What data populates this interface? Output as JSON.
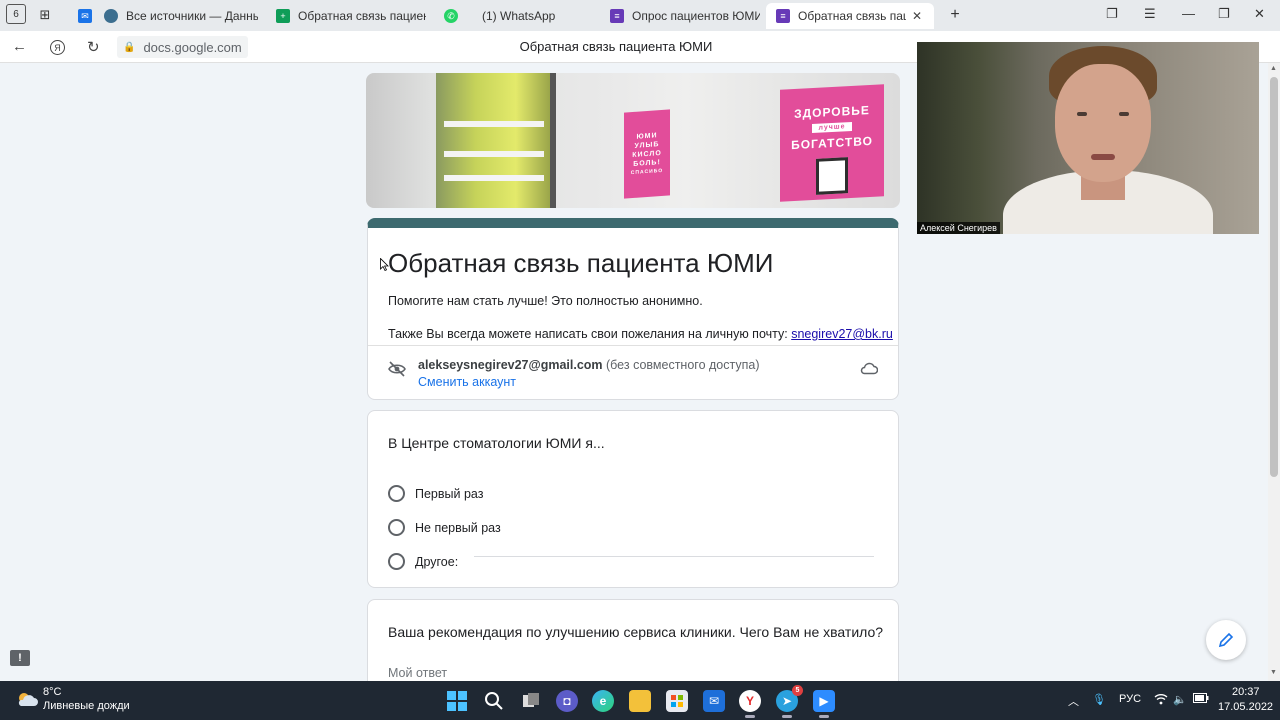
{
  "tabs": [
    {
      "label": "Все источники — Данные",
      "favicon_color": "#3c6e8f"
    },
    {
      "label": "Обратная связь пациента",
      "favicon_color": "#0f9d58"
    },
    {
      "label": "(1) WhatsApp",
      "favicon_color": "#25d366"
    },
    {
      "label": "Опрос пациентов ЮМИ",
      "favicon_color": "#673ab7"
    },
    {
      "label": "Обратная связь пациента",
      "favicon_color": "#673ab7",
      "active": true
    }
  ],
  "tab_strip": {
    "home_label": "6",
    "close_glyph": "✕",
    "new_tab_glyph": "+"
  },
  "address_bar": {
    "url": "docs.google.com",
    "page_title": "Обратная связь пациента ЮМИ"
  },
  "banner": {
    "poster_small_lines": [
      "ЮМИ",
      "УЛЫБ",
      "КИСЛО",
      "БОЛЬ!",
      "СПАСИБО"
    ],
    "poster_large_lines": [
      "ЗДОРОВЬЕ",
      "лучше",
      "БОГАТСТВО"
    ]
  },
  "form": {
    "title": "Обратная связь пациента ЮМИ",
    "description_1": "Помогите нам стать лучше! Это полностью анонимно.",
    "description_2": "Также Вы всегда можете написать свои пожелания на личную почту: ",
    "description_email": "snegirev27@bk.ru",
    "account_email": "alekseysnegirev27@gmail.com",
    "account_note": "(без совместного доступа)",
    "switch_account": "Сменить аккаунт"
  },
  "question_1": {
    "title": "В Центре стоматологии ЮМИ я...",
    "options": [
      "Первый раз",
      "Не первый раз",
      "Другое:"
    ]
  },
  "question_2": {
    "title": "Ваша рекомендация по улучшению сервиса клиники. Чего Вам не хватило?",
    "placeholder": "Мой ответ"
  },
  "video": {
    "participant_name": "Алексей Снегирев"
  },
  "taskbar": {
    "weather_temp": "8°C",
    "weather_desc": "Ливневые дожди",
    "language": "РУС",
    "time": "20:37",
    "date": "17.05.2022",
    "telegram_badge": "5"
  },
  "icons": {
    "accent": "#1a73e8",
    "form_theme": "#3d6a6f"
  }
}
